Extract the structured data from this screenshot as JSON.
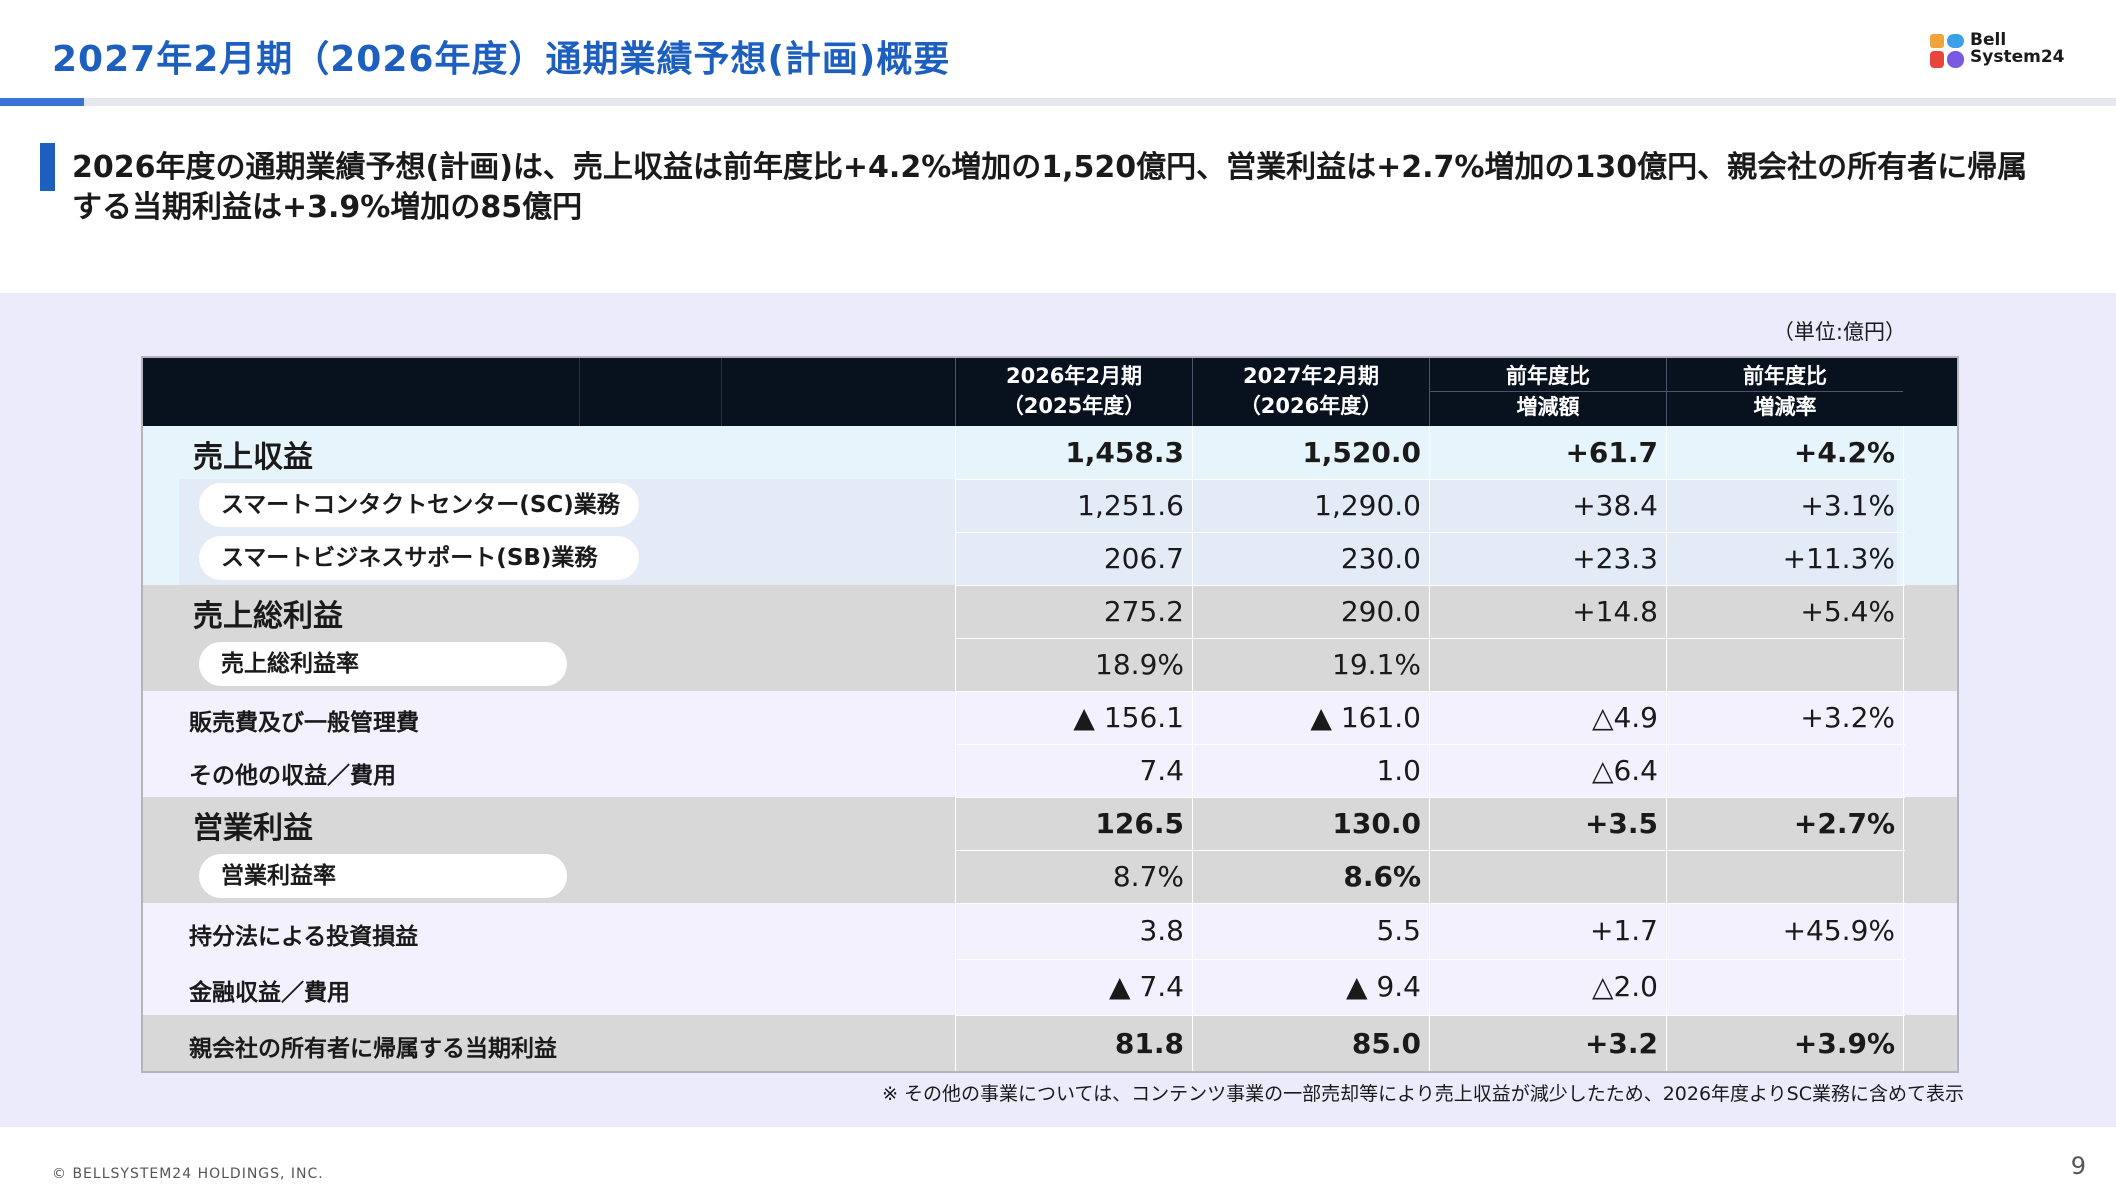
{
  "header": {
    "title": "2027年2月期（2026年度）通期業績予想(計画)概要",
    "logo_text_line1": "Bell",
    "logo_text_line2": "System24"
  },
  "lead": {
    "text": "2026年度の通期業績予想(計画)は、売上収益は前年度比+4.2%増加の1,520億円、営業利益は+2.7%増加の130億円、親会社の所有者に帰属する当期利益は+3.9%増加の85億円"
  },
  "unit": "（単位:億円）",
  "table": {
    "columns": [
      {
        "line1": "2026年2月期",
        "line2": "（2025年度）"
      },
      {
        "line1": "2027年2月期",
        "line2": "（2026年度）"
      },
      {
        "line1": "前年度比",
        "line2": "増減額"
      },
      {
        "line1": "前年度比",
        "line2": "増減率"
      }
    ],
    "rows": [
      {
        "label": "売上収益",
        "values": [
          "1,458.3",
          "1,520.0",
          "+61.7",
          "+4.2%"
        ]
      },
      {
        "label": "スマートコンタクトセンター(SC)業務",
        "values": [
          "1,251.6",
          "1,290.0",
          "+38.4",
          "+3.1%"
        ]
      },
      {
        "label": "スマートビジネスサポート(SB)業務",
        "values": [
          "206.7",
          "230.0",
          "+23.3",
          "+11.3%"
        ]
      },
      {
        "label": "売上総利益",
        "values": [
          "275.2",
          "290.0",
          "+14.8",
          "+5.4%"
        ]
      },
      {
        "label": "売上総利益率",
        "values": [
          "18.9%",
          "19.1%",
          "",
          ""
        ]
      },
      {
        "label": "販売費及び一般管理費",
        "values": [
          "▲ 156.1",
          "▲ 161.0",
          "△4.9",
          "+3.2%"
        ]
      },
      {
        "label": "その他の収益／費用",
        "values": [
          "7.4",
          "1.0",
          "△6.4",
          ""
        ]
      },
      {
        "label": "営業利益",
        "values": [
          "126.5",
          "130.0",
          "+3.5",
          "+2.7%"
        ]
      },
      {
        "label": "営業利益率",
        "values": [
          "8.7%",
          "8.6%",
          "",
          ""
        ]
      },
      {
        "label": "持分法による投資損益",
        "values": [
          "3.8",
          "5.5",
          "+1.7",
          "+45.9%"
        ]
      },
      {
        "label": "金融収益／費用",
        "values": [
          "▲ 7.4",
          "▲ 9.4",
          "△2.0",
          ""
        ]
      },
      {
        "label": "親会社の所有者に帰属する当期利益",
        "values": [
          "81.8",
          "85.0",
          "+3.2",
          "+3.9%"
        ]
      }
    ]
  },
  "footnote": "※ その他の事業については、コンテンツ事業の一部売却等により売上収益が減少したため、2026年度よりSC業務に含めて表示",
  "footer": {
    "copyright": "© BELLSYSTEM24 HOLDINGS, INC.",
    "page_number": "9"
  },
  "colors": {
    "title_blue": "#1c5fbf",
    "header_dark": "#08111e",
    "band_blue": "#e6f4fb",
    "band_gray": "#d8d8d8",
    "panel_lavender": "#ecebfb"
  }
}
